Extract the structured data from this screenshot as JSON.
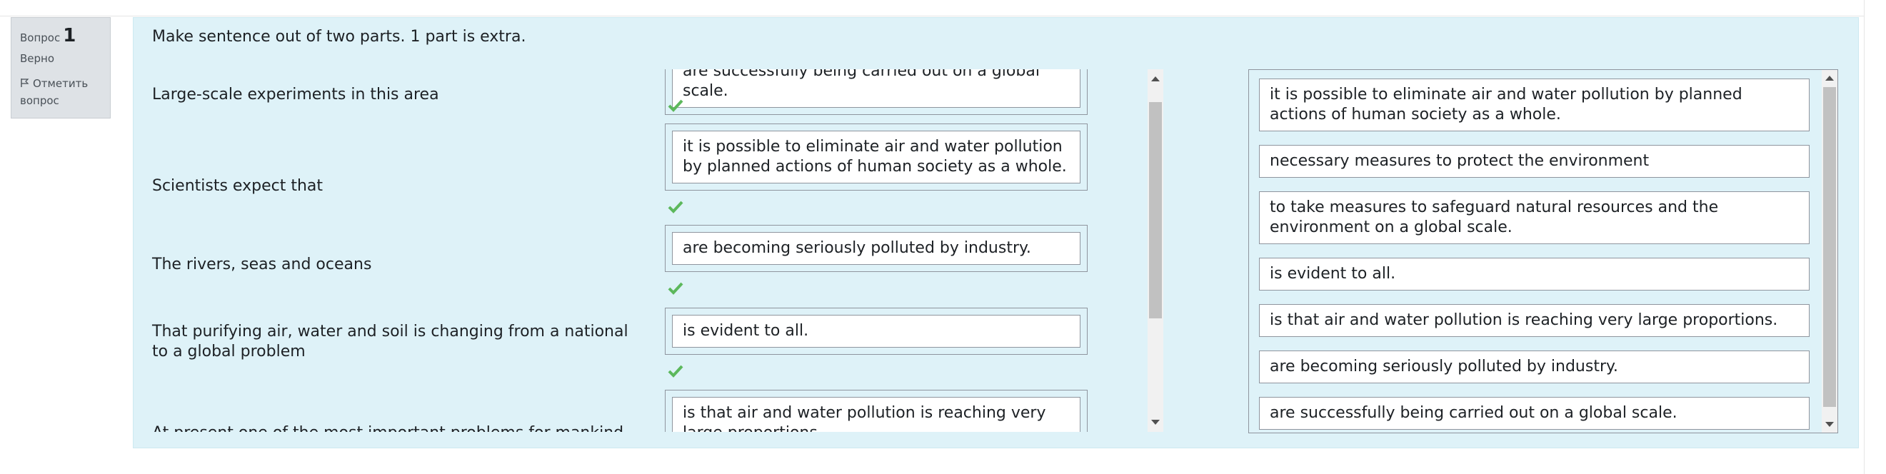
{
  "question_info": {
    "label": "Вопрос",
    "number": "1",
    "state": "Верно",
    "flag_label": "Отметить вопрос"
  },
  "question": {
    "text": "Make sentence out of two parts. 1 part is extra."
  },
  "pairs": [
    {
      "stem": "Large-scale experiments in this area",
      "answer": "are successfully being carried out on a global scale.",
      "correct": true
    },
    {
      "stem": "Scientists expect that",
      "answer": "it is possible to eliminate air and water pollution by planned actions of human society as a whole.",
      "correct": true
    },
    {
      "stem": "The rivers, seas and oceans",
      "answer": "are becoming seriously polluted by industry.",
      "correct": true
    },
    {
      "stem": "That purifying air, water and soil is changing from a national to a global problem",
      "answer": "is evident to all.",
      "correct": true
    },
    {
      "stem": "At present one of the most important problems for mankind",
      "answer": "is that air and water pollution is reaching very large proportions.",
      "correct": false
    }
  ],
  "choices": [
    "it is possible to eliminate air and water pollution by planned actions of human society as a whole.",
    "necessary measures to protect the environment",
    "to take measures to safeguard natural resources and the environment on a global scale.",
    "is evident to all.",
    "is that air and water pollution is reaching very large proportions.",
    "are becoming seriously polluted by industry.",
    "are successfully being carried out on a global scale."
  ],
  "colors": {
    "content_bg": "#def2f8",
    "info_bg": "#dee2e6",
    "check": "#5cb85c"
  }
}
